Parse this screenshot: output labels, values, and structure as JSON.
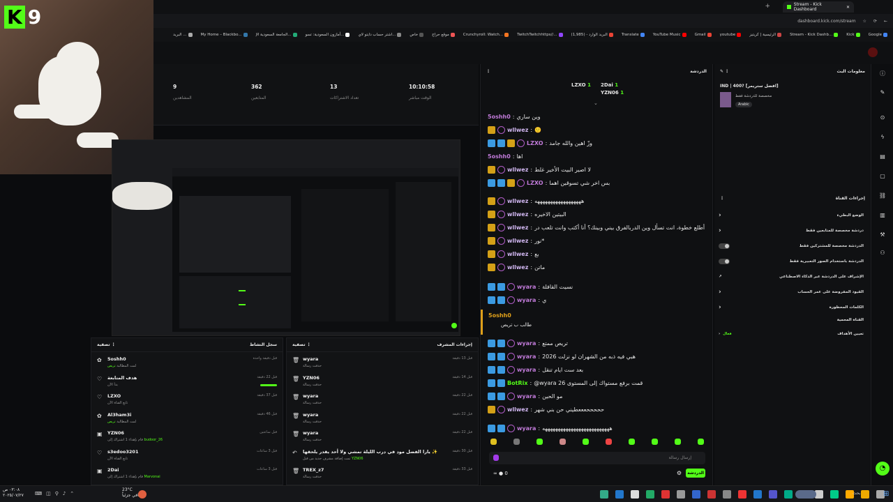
{
  "webcam": {
    "overlay_number": "9"
  },
  "browser": {
    "tab_title": "Stream - Kick Dashboard",
    "url": "dashboard.kick.com/stream",
    "bookmarks": [
      "Google",
      "Kick",
      "Stream - Kick Dashb...",
      "الرئيسية | كريتيز",
      "youtube",
      "Gmail",
      "YouTube Music",
      "Translate",
      "البريد الوارد - (1,985)",
      "TwitchTwitchhttps//...",
      "Crunchyroll: Watch...",
      "موقع حراج",
      "خاص",
      "اشتر حساب دايتو لاي...",
      "أمازون السعودية: تسو...",
      "الجامعة السعودية الإ...",
      "My Home – Blackbo...",
      "البريد ..."
    ]
  },
  "stats": [
    {
      "value": "10:10:58",
      "label": "الوقت مباشر"
    },
    {
      "value": "13",
      "label": "تعداد الاشتراكات"
    },
    {
      "value": "362",
      "label": "المتابعين"
    },
    {
      "value": "9",
      "label": "المشاهدين"
    }
  ],
  "activity_log": {
    "title": "سجل النشاط",
    "filter": "تصفية",
    "rows": [
      {
        "icon": "gift",
        "name": "5oshh0",
        "sub": "لمت المطالبة",
        "sub_hl": "تريص",
        "time": "قبل دقيقة واحدة"
      },
      {
        "icon": "heart",
        "name": "هدف المتابعة",
        "sub": "بدأ الآن",
        "time": "قبل 22 دقيقة"
      },
      {
        "icon": "heart",
        "name": "LZXO",
        "sub": "تابع القناة الآن",
        "time": "قبل 37 دقيقة"
      },
      {
        "icon": "gift",
        "name": "Al3ham3i",
        "sub": "لمت المطالبة",
        "sub_hl": "تريص",
        "time": "قبل 46 دقيقة"
      },
      {
        "icon": "sub",
        "name": "YZN06",
        "sub": "قام بإهداء 1 اشتراك إلى",
        "sub_hl": "budoor_26",
        "time": "قبل ساعتين"
      },
      {
        "icon": "heart",
        "name": "s3edoo3201",
        "sub": "تابع القناة الآن",
        "time": "قبل 3 ساعات"
      },
      {
        "icon": "sub",
        "name": "2Dai",
        "sub": "قام بإهداء 1 اشتراك إلى",
        "sub_hl": "Marvonai",
        "time": "قبل 3 ساعات"
      }
    ]
  },
  "mod_actions": {
    "title": "إجراءات المشرف",
    "filter": "تصفية",
    "rows": [
      {
        "icon": "trash",
        "name": "wyara",
        "sub": "حذفت رسالة",
        "time": "قبل 13 دقيقة"
      },
      {
        "icon": "trash",
        "name": "YZN06",
        "sub": "حذفت رسالة",
        "time": "قبل 14 دقيقة"
      },
      {
        "icon": "trash",
        "name": "wyara",
        "sub": "حذفت رسالة",
        "time": "قبل 22 دقيقة"
      },
      {
        "icon": "trash",
        "name": "wyara",
        "sub": "حذفت رسالة",
        "time": "قبل 22 دقيقة"
      },
      {
        "icon": "trash",
        "name": "wyara",
        "sub": "حذفت رسالة",
        "time": "قبل 22 دقيقة"
      },
      {
        "icon": "undo",
        "name": "يارا الفضل مود في درب الليلة تمشي ولا أحد يقدر يلحقها ✨",
        "sub": "تمت إضافة مشرف جديد من قبل",
        "sub_hl": "YZN06",
        "time": "قبل 30 دقيقة"
      },
      {
        "icon": "trash",
        "name": "TREX_z7",
        "sub": "حذفت رسالة",
        "time": "قبل 33 دقيقة"
      }
    ]
  },
  "chat": {
    "title": "الدردشة",
    "leaderboard": [
      {
        "name": "LZXO",
        "count": "1"
      },
      {
        "name": "2Dai",
        "count": "1"
      },
      {
        "name": "YZN06",
        "count": "1"
      }
    ],
    "messages": [
      {
        "user": "5oshh0",
        "color": "#c07ad8",
        "badges": [],
        "text": "وين ساري"
      },
      {
        "user": "wllwez",
        "color": "#d0b6f0",
        "badges": [
          "gold",
          "circ"
        ],
        "text": "🙂"
      },
      {
        "user": "LZXO",
        "color": "#c07ad8",
        "badges": [
          "blue",
          "blue",
          "gold",
          "circ"
        ],
        "text": "وزّ اهين والله جامد"
      },
      {
        "user": "5oshh0",
        "color": "#c07ad8",
        "badges": [],
        "text": "اها"
      },
      {
        "user": "wllwez",
        "color": "#d0b6f0",
        "badges": [
          "gold",
          "circ"
        ],
        "text": "لا اصير البيت الأخير غلط"
      },
      {
        "user": "LZXO",
        "color": "#c07ad8",
        "badges": [
          "blue",
          "blue",
          "gold",
          "circ"
        ],
        "text": "بس اخر شي تسوقين اهما"
      },
      {
        "user": "wllwez",
        "color": "#d0b6f0",
        "badges": [
          "gold",
          "circ"
        ],
        "text": "ههههههههههههههههههه"
      },
      {
        "user": "wllwez",
        "color": "#d0b6f0",
        "badges": [
          "gold",
          "circ"
        ],
        "text": "البيتين الاخيره"
      },
      {
        "user": "wllwez",
        "color": "#d0b6f0",
        "badges": [
          "gold",
          "circ"
        ],
        "text": "أنا أطلع خطوة، انت تسأل وين الدربالفرق بيني وبينك؟ أنا أكتب وانت تلعب در"
      },
      {
        "user": "wllwez",
        "color": "#d0b6f0",
        "badges": [
          "gold",
          "circ"
        ],
        "text": "نور*"
      },
      {
        "user": "wllwez",
        "color": "#d0b6f0",
        "badges": [
          "gold",
          "circ"
        ],
        "text": "بع"
      },
      {
        "user": "wllwez",
        "color": "#d0b6f0",
        "badges": [
          "gold",
          "circ"
        ],
        "text": "ماتن"
      },
      {
        "user": "wyara",
        "color": "#c07ad8",
        "badges": [
          "blue",
          "blue",
          "circ"
        ],
        "text": "نسيت القافلة"
      },
      {
        "user": "wyara",
        "color": "#c07ad8",
        "badges": [
          "blue",
          "blue",
          "circ"
        ],
        "text": "ي"
      },
      {
        "user": "wyara",
        "color": "#c07ad8",
        "badges": [
          "blue",
          "blue",
          "circ"
        ],
        "text": "تريص ممتع"
      },
      {
        "user": "wyara",
        "color": "#c07ad8",
        "badges": [
          "blue",
          "blue",
          "circ"
        ],
        "text": "هبي فيه ذبه من الشهران لو نزلت 2026"
      },
      {
        "user": "wyara",
        "color": "#c07ad8",
        "badges": [
          "blue",
          "blue",
          "circ"
        ],
        "text": "بعد ست ايام تنقل"
      },
      {
        "user": "BotRix",
        "color": "#53fc18",
        "badges": [
          "blue",
          "blue"
        ],
        "text": "@wyara قمت برفع مستواك إلى المستوى 26"
      },
      {
        "user": "wyara",
        "color": "#c07ad8",
        "badges": [
          "blue",
          "blue",
          "circ"
        ],
        "text": "مو الحين"
      },
      {
        "user": "wllwez",
        "color": "#d0b6f0",
        "badges": [
          "gold",
          "circ"
        ],
        "text": "حححححعععطيني حن بني شهر"
      },
      {
        "user": "wyara",
        "color": "#c07ad8",
        "badges": [
          "blue",
          "blue",
          "circ"
        ],
        "text": "ههههههههههههههههههههههههههه"
      }
    ],
    "pinned": {
      "user": "5oshh0",
      "text": "طالب ب تريص"
    },
    "composer_placeholder": "إرسال رسالة",
    "send_label": "الدردشة",
    "viewer_count": "0"
  },
  "side": {
    "stream_info_title": "معلومات البث",
    "stream_title": "IND | 400? [افضل ستريمر]",
    "stream_sub": "مخصصة للدردشة فقط",
    "language": "Arabic",
    "channel_actions_title": "إجراءات القناة",
    "options": [
      {
        "label": "الوضع البطيء",
        "kind": "arrow"
      },
      {
        "label": "دردشة مخصصة للمتابعين فقط",
        "kind": "arrow"
      },
      {
        "label": "الدردشة مخصصة للمشتركين فقط",
        "kind": "toggle"
      },
      {
        "label": "الدردشة باستخدام الصور التعبيرية فقط",
        "kind": "toggle"
      },
      {
        "label": "الإشراف على الدردشة عبر الذكاء الاصطناعي",
        "kind": "ext"
      },
      {
        "label": "القيود المفروضة على عمر الحساب",
        "kind": "arrow"
      },
      {
        "label": "الكلمات المحظورة",
        "kind": "arrow"
      }
    ],
    "blocked_label": "القناة المحمية",
    "goals_label": "تعيين الأهداف",
    "goals_state": "فعال"
  },
  "taskbar": {
    "weather": "23°C",
    "weather_sub": "صافي جزئياً",
    "time": "٠٣:٠٨ ص",
    "date": "٢٠٢٥/٠٧/٢٧",
    "search": "بحث"
  },
  "colors": {
    "kick_green": "#53fc18",
    "gold_badge": "#d4a017",
    "blue_badge": "#3b9ae1"
  }
}
